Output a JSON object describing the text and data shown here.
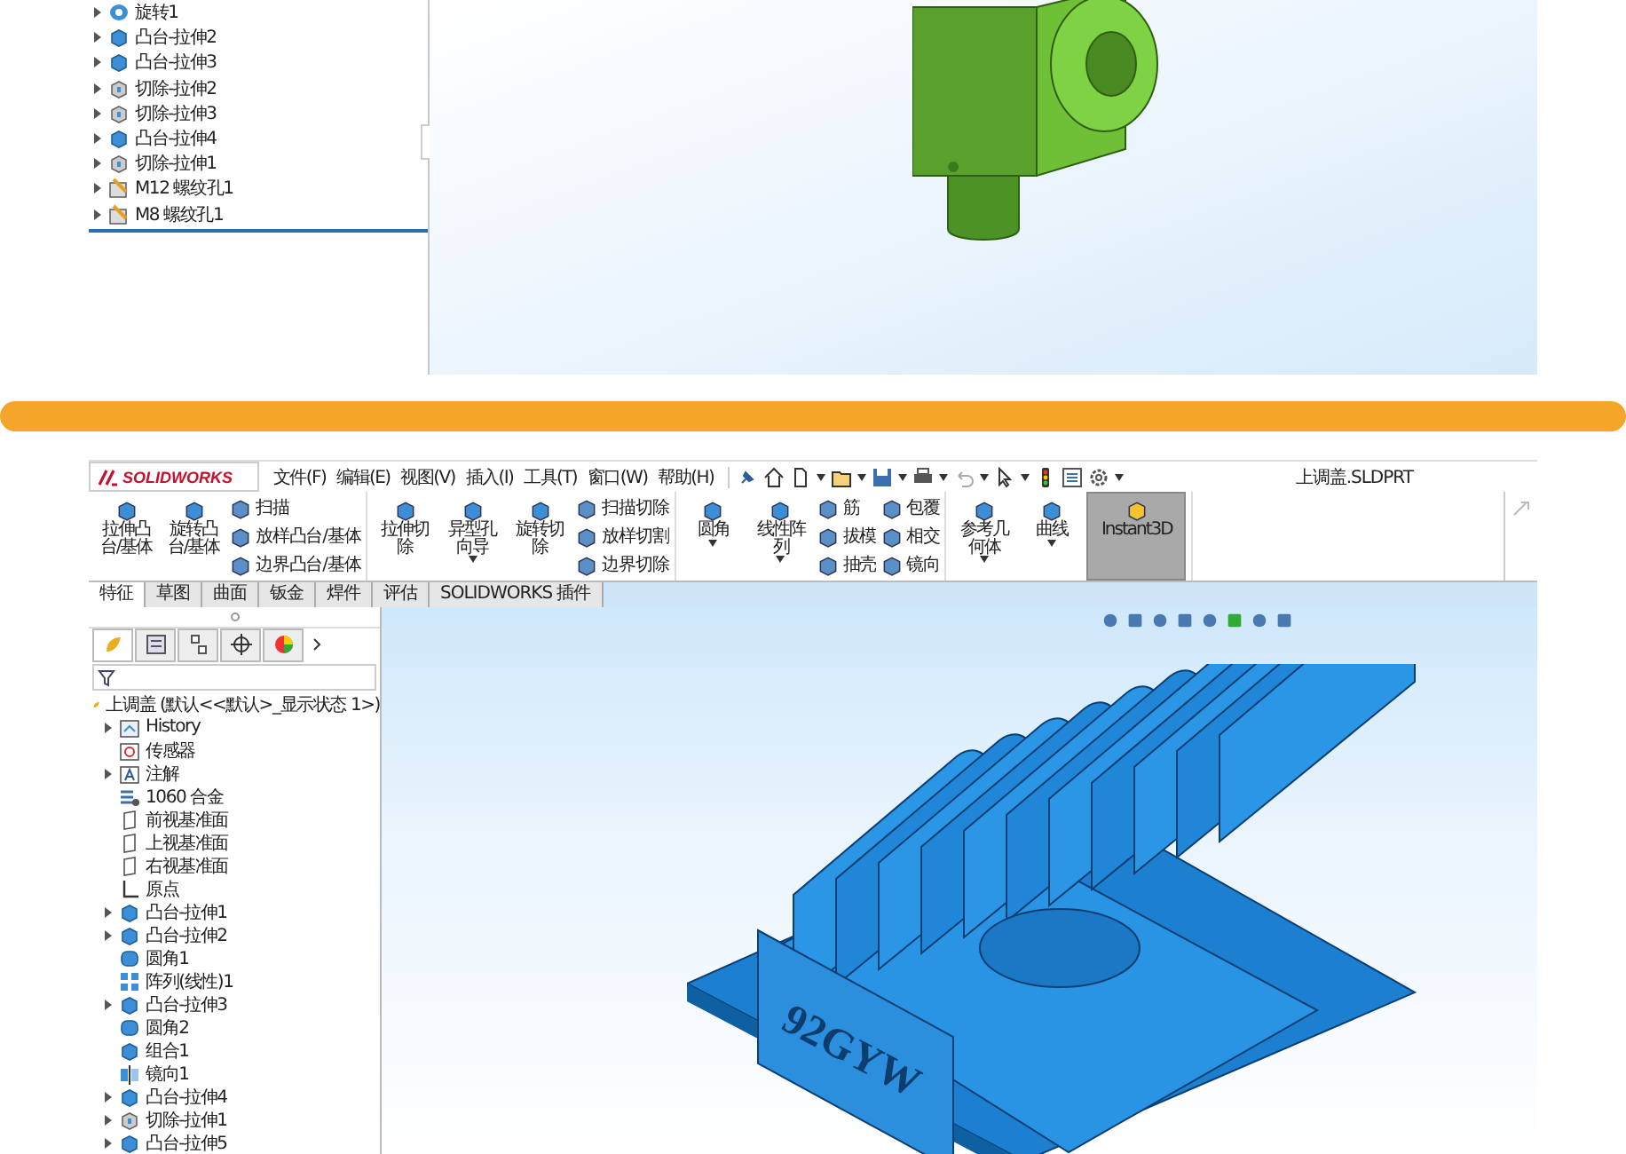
{
  "top_panel": {
    "feature_tree": [
      {
        "label": "旋转1",
        "kind": "revolve",
        "expandable": true
      },
      {
        "label": "凸台-拉伸2",
        "kind": "boss",
        "expandable": true
      },
      {
        "label": "凸台-拉伸3",
        "kind": "boss",
        "expandable": true
      },
      {
        "label": "切除-拉伸2",
        "kind": "cut",
        "expandable": true
      },
      {
        "label": "切除-拉伸3",
        "kind": "cut",
        "expandable": true
      },
      {
        "label": "凸台-拉伸4",
        "kind": "boss",
        "expandable": true
      },
      {
        "label": "切除-拉伸1",
        "kind": "cut",
        "expandable": true
      },
      {
        "label": "M12 螺纹孔1",
        "kind": "hole",
        "expandable": true
      },
      {
        "label": "M8 螺纹孔1",
        "kind": "hole",
        "expandable": true
      }
    ]
  },
  "bottom_panel": {
    "app_name": "SOLIDWORKS",
    "menus": [
      "文件(F)",
      "编辑(E)",
      "视图(V)",
      "插入(I)",
      "工具(T)",
      "窗口(W)",
      "帮助(H)"
    ],
    "document_title": "上调盖.SLDPRT",
    "ribbon_groups": [
      {
        "large": [
          {
            "label": "拉伸凸台/基体",
            "dropdown": false
          },
          {
            "label": "旋转凸台/基体",
            "dropdown": false
          }
        ],
        "small_columns": [
          [
            "扫描",
            "放样凸台/基体",
            "边界凸台/基体"
          ]
        ]
      },
      {
        "large": [
          {
            "label": "拉伸切除",
            "dropdown": false
          },
          {
            "label": "异型孔向导",
            "dropdown": true
          },
          {
            "label": "旋转切除",
            "dropdown": false
          }
        ],
        "small_columns": [
          [
            "扫描切除",
            "放样切割",
            "边界切除"
          ]
        ]
      },
      {
        "large": [
          {
            "label": "圆角",
            "dropdown": true
          },
          {
            "label": "线性阵列",
            "dropdown": true
          }
        ],
        "small_columns": [
          [
            "筋",
            "拔模",
            "抽壳"
          ],
          [
            "包覆",
            "相交",
            "镜向"
          ]
        ]
      },
      {
        "large": [
          {
            "label": "参考几何体",
            "dropdown": true
          },
          {
            "label": "曲线",
            "dropdown": true
          },
          {
            "label": "Instant3D",
            "dropdown": false,
            "selected": true
          }
        ]
      }
    ],
    "panel_tabs": [
      {
        "selected": true
      },
      {
        "selected": false
      },
      {
        "selected": false
      },
      {
        "selected": false
      },
      {
        "selected": false
      }
    ],
    "tabs": [
      {
        "label": "特征",
        "selected": true
      },
      {
        "label": "草图",
        "selected": false
      },
      {
        "label": "曲面",
        "selected": false
      },
      {
        "label": "钣金",
        "selected": false
      },
      {
        "label": "焊件",
        "selected": false
      },
      {
        "label": "评估",
        "selected": false
      },
      {
        "label": "SOLIDWORKS 插件",
        "selected": false
      }
    ],
    "tree_root": "上调盖 (默认<<默认>_显示状态 1>)",
    "feature_tree": [
      {
        "label": "History",
        "kind": "folder",
        "expandable": true
      },
      {
        "label": "传感器",
        "kind": "sensor",
        "expandable": false
      },
      {
        "label": "注解",
        "kind": "annotation",
        "expandable": true
      },
      {
        "label": "1060 合金",
        "kind": "material",
        "expandable": false
      },
      {
        "label": "前视基准面",
        "kind": "plane",
        "expandable": false
      },
      {
        "label": "上视基准面",
        "kind": "plane",
        "expandable": false
      },
      {
        "label": "右视基准面",
        "kind": "plane",
        "expandable": false
      },
      {
        "label": "原点",
        "kind": "origin",
        "expandable": false
      },
      {
        "label": "凸台-拉伸1",
        "kind": "boss",
        "expandable": true
      },
      {
        "label": "凸台-拉伸2",
        "kind": "boss",
        "expandable": true
      },
      {
        "label": "圆角1",
        "kind": "fillet",
        "expandable": false
      },
      {
        "label": "阵列(线性)1",
        "kind": "pattern",
        "expandable": false
      },
      {
        "label": "凸台-拉伸3",
        "kind": "boss",
        "expandable": true
      },
      {
        "label": "圆角2",
        "kind": "fillet",
        "expandable": false
      },
      {
        "label": "组合1",
        "kind": "boss",
        "expandable": false
      },
      {
        "label": "镜向1",
        "kind": "mirror",
        "expandable": false
      },
      {
        "label": "凸台-拉伸4",
        "kind": "boss",
        "expandable": true
      },
      {
        "label": "切除-拉伸1",
        "kind": "cut",
        "expandable": true
      },
      {
        "label": "凸台-拉伸5",
        "kind": "boss",
        "expandable": true
      }
    ],
    "model_text": "92GYW"
  }
}
